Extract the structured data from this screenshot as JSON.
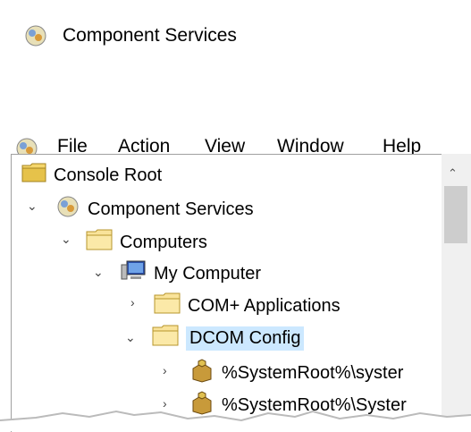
{
  "window": {
    "title": "Component Services"
  },
  "menu": [
    "File",
    "Action",
    "View",
    "Window",
    "Help"
  ],
  "toolbar": [
    "back-icon",
    "forward-icon",
    "up-folder-icon",
    "show-hide-tree-icon",
    "delete-icon",
    "properties-icon",
    "refresh-icon",
    "help-icon",
    "show-hide-action-icon",
    "export-icon"
  ],
  "tree": {
    "root": "Console Root",
    "component_services": "Component Services",
    "computers": "Computers",
    "my_computer": "My Computer",
    "com_apps": "COM+ Applications",
    "dcom_config": "DCOM Config",
    "item1": "%SystemRoot%\\syster",
    "item2": "%SystemRoot%\\Syster"
  },
  "colors": {
    "selection": "#cce8ff",
    "folder": "#f5d66b"
  }
}
